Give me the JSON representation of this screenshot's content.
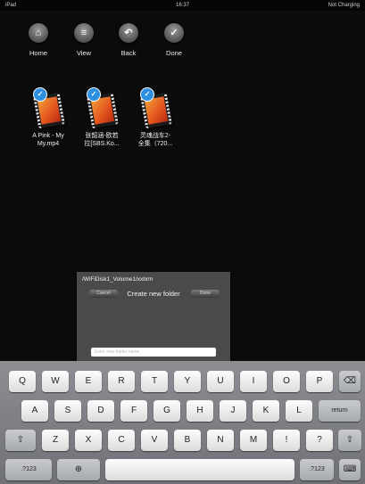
{
  "status": {
    "device": "iPad",
    "time": "16:37",
    "battery": "Not Charging"
  },
  "toolbar": [
    {
      "label": "Home",
      "icon": "home-icon",
      "glyph": "⌂"
    },
    {
      "label": "View",
      "icon": "menu-icon",
      "glyph": "≡"
    },
    {
      "label": "Back",
      "icon": "back-arrow-icon",
      "glyph": "↶"
    },
    {
      "label": "Done",
      "icon": "checkmark-icon",
      "glyph": "✓"
    }
  ],
  "files": [
    {
      "line1": "A Pink - My",
      "line2": "My.mp4"
    },
    {
      "line1": "张韶涵-欧若",
      "line2": "拉[SBS.Ko..."
    },
    {
      "line1": "灵魂战车2-",
      "line2": "全集（720..."
    }
  ],
  "dialog": {
    "path": "/WiFiDisk1_Volume1/xxbrm",
    "cancel": "Cancel",
    "title": "Create new folder",
    "done": "Done",
    "placeholder": "Enter new folder name"
  },
  "keyboard": {
    "row1": [
      "Q",
      "W",
      "E",
      "R",
      "T",
      "Y",
      "U",
      "I",
      "O",
      "P"
    ],
    "backspace_glyph": "⌫",
    "row2": [
      "A",
      "S",
      "D",
      "F",
      "G",
      "H",
      "J",
      "K",
      "L"
    ],
    "return": "return",
    "shift_glyph": "⇧",
    "row3": [
      "Z",
      "X",
      "C",
      "V",
      "B",
      "N",
      "M",
      "!",
      "?"
    ],
    "numbers": ".?123",
    "globe_glyph": "⊕",
    "hide_glyph": "⌨"
  }
}
